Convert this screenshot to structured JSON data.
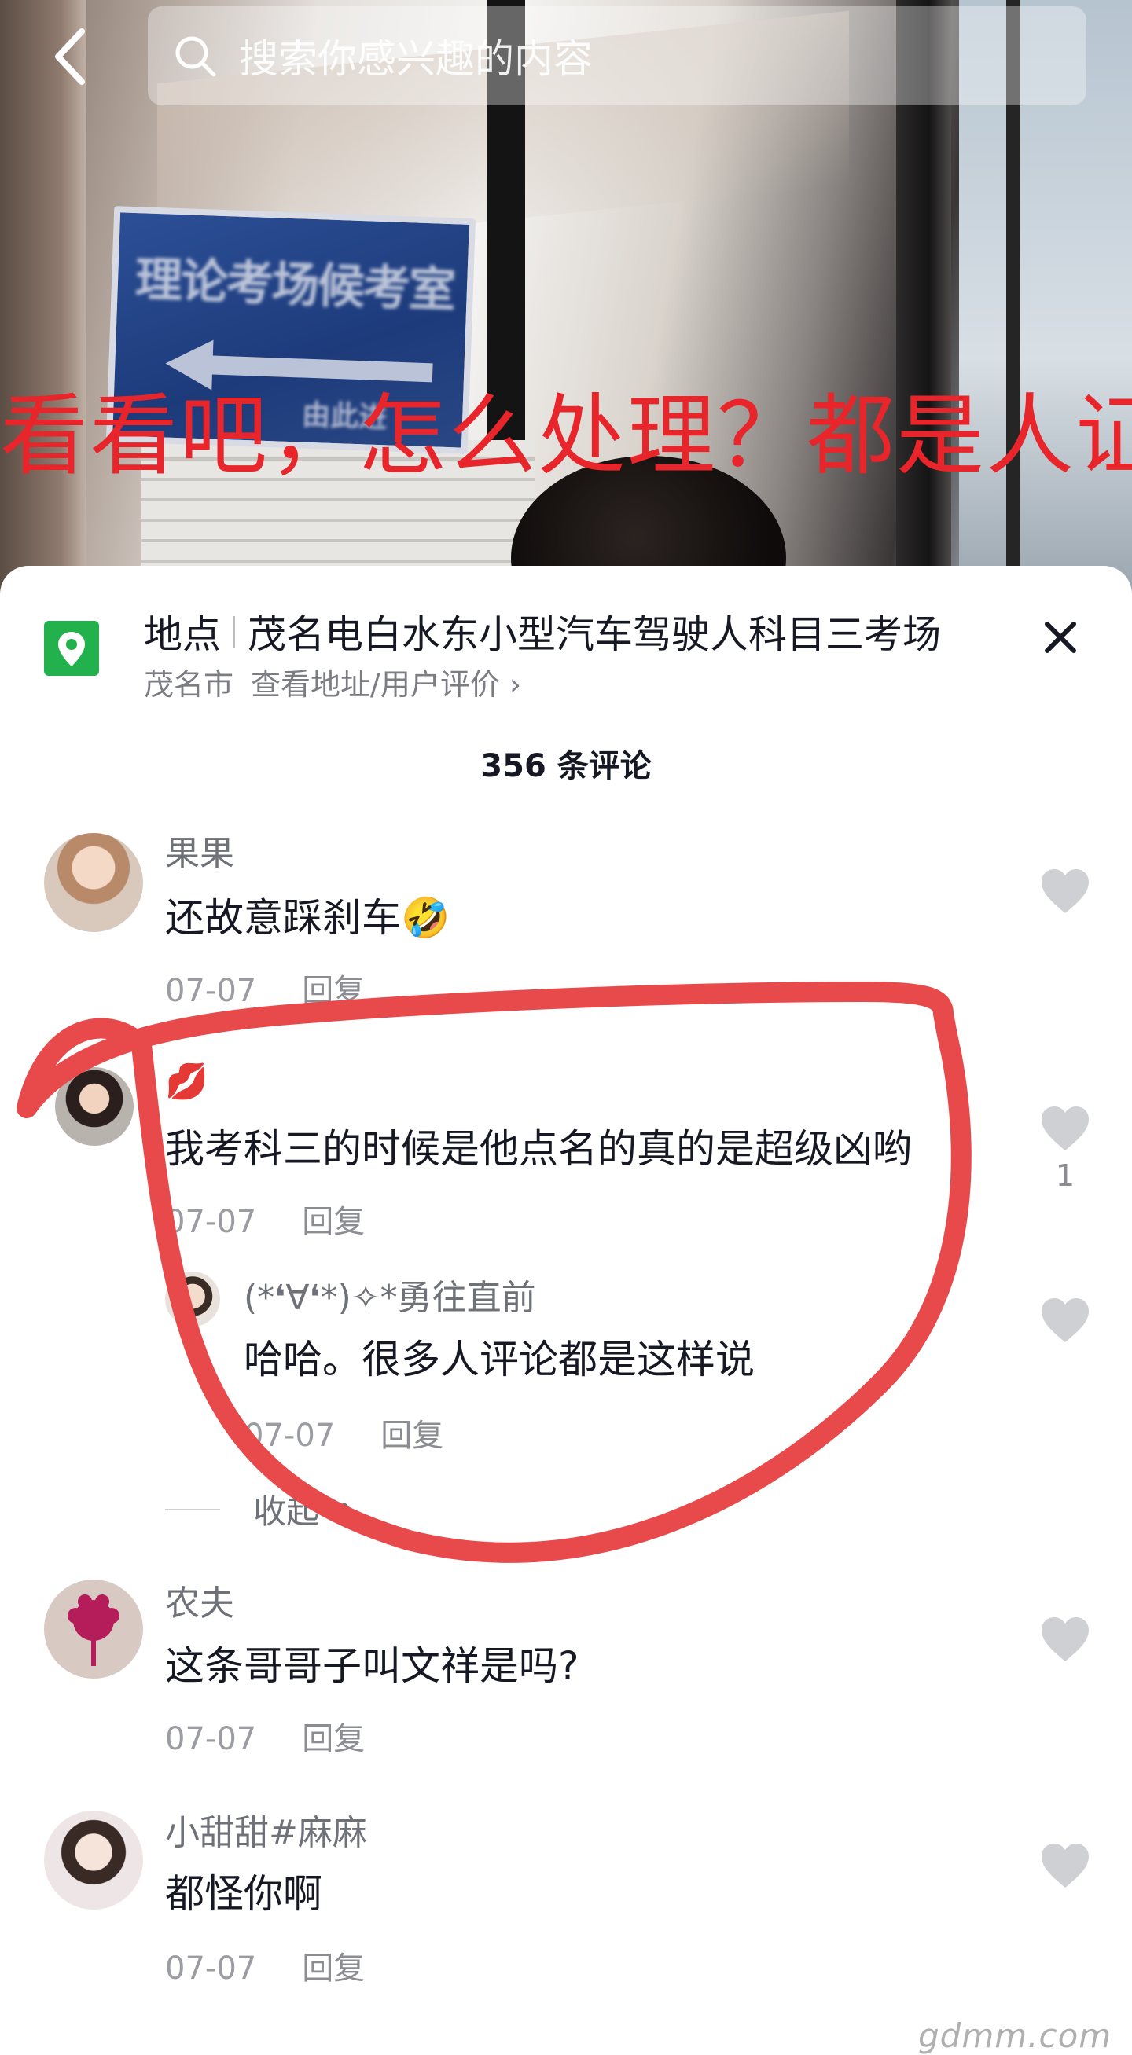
{
  "search": {
    "placeholder": "搜索你感兴趣的内容"
  },
  "video": {
    "caption": "看看吧，怎么处理？都是人证",
    "sign_text": "理论考场候考室",
    "sign_sub": "由此进"
  },
  "location": {
    "label": "地点",
    "name": "茂名电白水东小型汽车驾驶人科目三考场",
    "city": "茂名市",
    "link": "查看地址/用户评价 ›"
  },
  "comments_header": {
    "count_text": "356 条评论"
  },
  "comments": [
    {
      "user": "果果",
      "text": "还故意踩刹车🤣",
      "date": "07-07",
      "reply": "回复",
      "likes": ""
    },
    {
      "user": "💋",
      "text": "我考科三的时候是他点名的真的是超级凶哟",
      "date": "07-07",
      "reply": "回复",
      "likes": "1",
      "replies": [
        {
          "user": "(*❛∀❛*)✧*勇往直前",
          "text": "哈哈。很多人评论都是这样说",
          "date": "07-07",
          "reply": "回复"
        }
      ],
      "collapse_label": "收起"
    },
    {
      "user": "农夫",
      "text": "这条哥哥子叫文祥是吗?",
      "date": "07-07",
      "reply": "回复",
      "likes": ""
    },
    {
      "user": "小甜甜#麻麻",
      "text": "都怪你啊",
      "date": "07-07",
      "reply": "回复",
      "likes": ""
    }
  ],
  "watermark": "gdmm.com",
  "colors": {
    "annotation_red": "#e8494a",
    "location_green": "#22b14c",
    "caption_red": "#e8252a"
  }
}
